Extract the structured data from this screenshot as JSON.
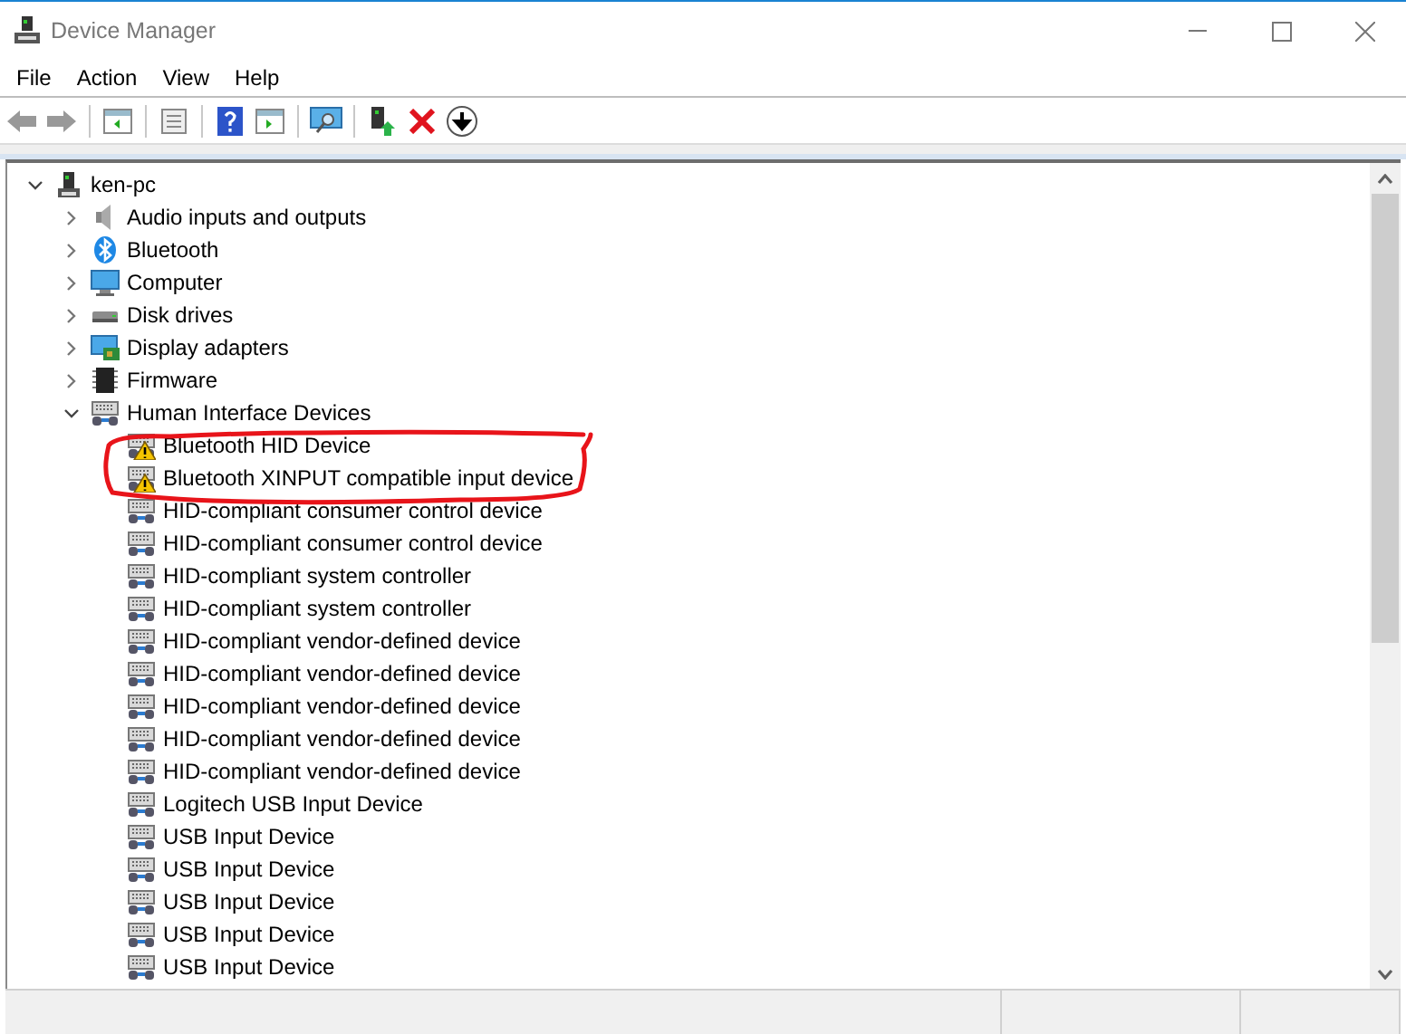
{
  "window": {
    "title": "Device Manager"
  },
  "menu": [
    "File",
    "Action",
    "View",
    "Help"
  ],
  "tree": {
    "label": "ken-pc",
    "kind": "computer",
    "expanded": true,
    "children": [
      {
        "label": "Audio inputs and outputs",
        "kind": "speaker",
        "expanded": false
      },
      {
        "label": "Bluetooth",
        "kind": "bluetooth",
        "expanded": false
      },
      {
        "label": "Computer",
        "kind": "monitor",
        "expanded": false
      },
      {
        "label": "Disk drives",
        "kind": "disk",
        "expanded": false
      },
      {
        "label": "Display adapters",
        "kind": "display",
        "expanded": false
      },
      {
        "label": "Firmware",
        "kind": "chip",
        "expanded": false
      },
      {
        "label": "Human Interface Devices",
        "kind": "hid",
        "expanded": true,
        "children": [
          {
            "label": "Bluetooth HID Device",
            "kind": "hid",
            "warning": true
          },
          {
            "label": "Bluetooth XINPUT compatible input device",
            "kind": "hid",
            "warning": true
          },
          {
            "label": "HID-compliant consumer control device",
            "kind": "hid",
            "warning": false
          },
          {
            "label": "HID-compliant consumer control device",
            "kind": "hid",
            "warning": false
          },
          {
            "label": "HID-compliant system controller",
            "kind": "hid",
            "warning": false
          },
          {
            "label": "HID-compliant system controller",
            "kind": "hid",
            "warning": false
          },
          {
            "label": "HID-compliant vendor-defined device",
            "kind": "hid",
            "warning": false
          },
          {
            "label": "HID-compliant vendor-defined device",
            "kind": "hid",
            "warning": false
          },
          {
            "label": "HID-compliant vendor-defined device",
            "kind": "hid",
            "warning": false
          },
          {
            "label": "HID-compliant vendor-defined device",
            "kind": "hid",
            "warning": false
          },
          {
            "label": "HID-compliant vendor-defined device",
            "kind": "hid",
            "warning": false
          },
          {
            "label": "Logitech USB Input Device",
            "kind": "hid",
            "warning": false
          },
          {
            "label": "USB Input Device",
            "kind": "hid",
            "warning": false
          },
          {
            "label": "USB Input Device",
            "kind": "hid",
            "warning": false
          },
          {
            "label": "USB Input Device",
            "kind": "hid",
            "warning": false
          },
          {
            "label": "USB Input Device",
            "kind": "hid",
            "warning": false
          },
          {
            "label": "USB Input Device",
            "kind": "hid",
            "warning": false
          }
        ]
      }
    ]
  }
}
